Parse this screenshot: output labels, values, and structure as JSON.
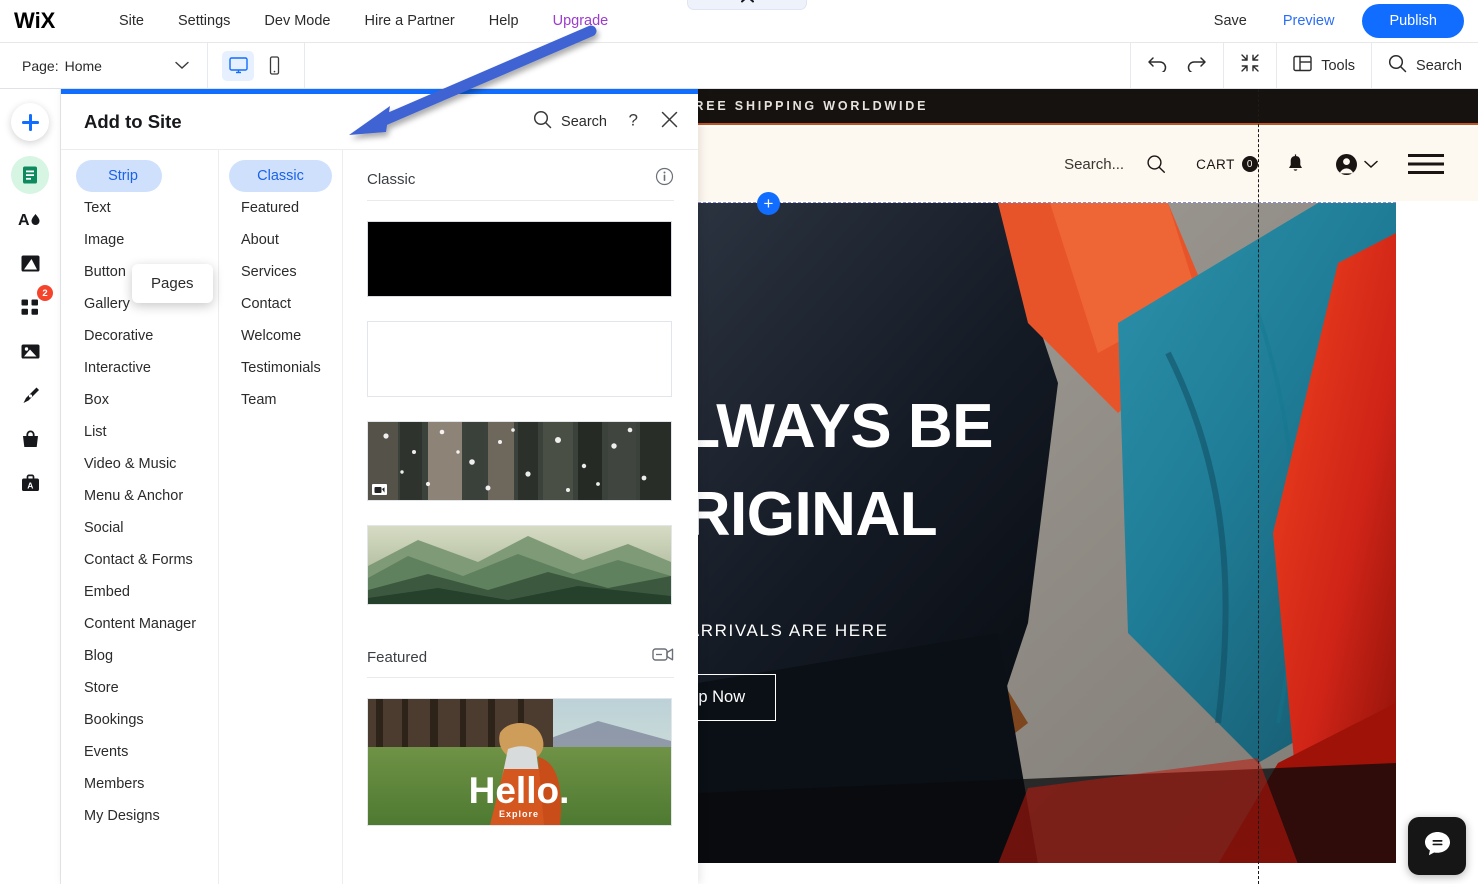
{
  "topbar": {
    "logo": "WIX",
    "nav": [
      {
        "label": "Site",
        "accent": false
      },
      {
        "label": "Settings",
        "accent": false
      },
      {
        "label": "Dev Mode",
        "accent": false
      },
      {
        "label": "Hire a Partner",
        "accent": false
      },
      {
        "label": "Help",
        "accent": false
      },
      {
        "label": "Upgrade",
        "accent": true
      }
    ],
    "save_label": "Save",
    "preview_label": "Preview",
    "publish_label": "Publish",
    "publish_color": "#116dff",
    "upgrade_color": "#9c3bcd"
  },
  "secondbar": {
    "page_label": "Page:",
    "page_value": "Home",
    "chevron_icon": "chevron-down-icon",
    "desktop_icon": "desktop-view-icon",
    "mobile_icon": "mobile-view-icon",
    "undo_icon": "undo-icon",
    "redo_icon": "redo-icon",
    "zoomout_icon": "zoom-out-icon",
    "tools_label": "Tools",
    "tools_icon": "layout-panel-icon",
    "search_label": "Search",
    "search_icon": "search-icon"
  },
  "rail": {
    "items": [
      {
        "name": "add-elements",
        "icon": "plus-icon",
        "badge": null
      },
      {
        "name": "site-pages",
        "icon": "page-document-icon",
        "badge": null
      },
      {
        "name": "site-design",
        "icon": "theme-paint-icon",
        "badge": null
      },
      {
        "name": "background",
        "icon": "background-image-icon",
        "badge": null
      },
      {
        "name": "apps",
        "icon": "apps-grid-icon",
        "badge": "2"
      },
      {
        "name": "media",
        "icon": "media-picture-icon",
        "badge": null
      },
      {
        "name": "blog",
        "icon": "pen-nib-icon",
        "badge": null
      },
      {
        "name": "store",
        "icon": "shopping-bag-icon",
        "badge": null
      },
      {
        "name": "business",
        "icon": "briefcase-icon",
        "badge": null
      }
    ]
  },
  "panel": {
    "title": "Add to Site",
    "search_label": "Search",
    "search_icon": "search-icon",
    "help_icon": "question-mark-icon",
    "close_icon": "close-icon",
    "accent_color": "#116dff",
    "categories": [
      {
        "label": "Strip",
        "selected": true
      },
      {
        "label": "Text",
        "selected": false
      },
      {
        "label": "Image",
        "selected": false
      },
      {
        "label": "Button",
        "selected": false
      },
      {
        "label": "Gallery",
        "selected": false
      },
      {
        "label": "Decorative",
        "selected": false
      },
      {
        "label": "Interactive",
        "selected": false
      },
      {
        "label": "Box",
        "selected": false
      },
      {
        "label": "List",
        "selected": false
      },
      {
        "label": "Video & Music",
        "selected": false
      },
      {
        "label": "Menu & Anchor",
        "selected": false
      },
      {
        "label": "Social",
        "selected": false
      },
      {
        "label": "Contact & Forms",
        "selected": false
      },
      {
        "label": "Embed",
        "selected": false
      },
      {
        "label": "Content Manager",
        "selected": false
      },
      {
        "label": "Blog",
        "selected": false
      },
      {
        "label": "Store",
        "selected": false
      },
      {
        "label": "Bookings",
        "selected": false
      },
      {
        "label": "Events",
        "selected": false
      },
      {
        "label": "Members",
        "selected": false
      },
      {
        "label": "My Designs",
        "selected": false
      }
    ],
    "subcategories": [
      {
        "label": "Classic",
        "selected": true
      },
      {
        "label": "Featured",
        "selected": false
      },
      {
        "label": "About",
        "selected": false
      },
      {
        "label": "Services",
        "selected": false
      },
      {
        "label": "Contact",
        "selected": false
      },
      {
        "label": "Welcome",
        "selected": false
      },
      {
        "label": "Testimonials",
        "selected": false
      },
      {
        "label": "Team",
        "selected": false
      }
    ],
    "sections": [
      {
        "title": "Classic",
        "icon": "info-circle-icon",
        "thumbs": [
          {
            "kind": "black",
            "video": false,
            "name": "strip-thumb-black"
          },
          {
            "kind": "blank",
            "video": false,
            "name": "strip-thumb-blank"
          },
          {
            "kind": "forest",
            "video": true,
            "name": "strip-thumb-snowy-forest"
          },
          {
            "kind": "mountains",
            "video": false,
            "name": "strip-thumb-mountains"
          }
        ]
      },
      {
        "title": "Featured",
        "icon": "video-strip-icon",
        "thumbs": [
          {
            "kind": "hello",
            "video": false,
            "name": "strip-thumb-hello",
            "overlay_title": "Hello.",
            "overlay_sub": "Explore"
          }
        ]
      }
    ],
    "tooltip": {
      "label": "Pages"
    }
  },
  "canvas": {
    "announcement": "FREE SHIPPING WORLDWIDE",
    "announcement_bg": "#15120f",
    "announcement_accent": "#c2551f",
    "header_bg": "#fdf8f0",
    "search_placeholder": "Search...",
    "search_icon": "search-icon",
    "cart_label": "CART",
    "cart_count": "0",
    "bell_icon": "notification-bell-icon",
    "account_icon": "account-avatar-icon",
    "account_chevron_icon": "chevron-down-icon",
    "hamburger_icon": "hamburger-menu-icon",
    "hero_line1": "ALWAYS BE",
    "hero_line2": "ORIGINAL",
    "hero_sub": "NEW ARRIVALS ARE HERE",
    "hero_cta": "Shop Now",
    "add_section_icon": "plus-icon",
    "chat_icon": "chat-bubble-icon",
    "collapse_icon": "chevron-up-icon"
  },
  "annotation": {
    "arrow_color": "#4164d4",
    "arrow_name": "pointer-arrow-annotation"
  }
}
